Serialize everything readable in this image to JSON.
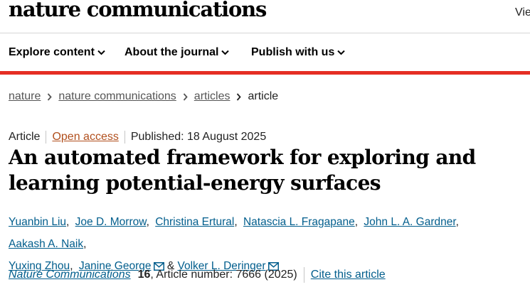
{
  "header": {
    "logo_text": "nature communications",
    "view_text": "Vie"
  },
  "nav": {
    "items": [
      {
        "label": "Explore content"
      },
      {
        "label": "About the journal"
      },
      {
        "label": "Publish with us"
      }
    ]
  },
  "breadcrumb": {
    "items": [
      "nature",
      "nature communications",
      "articles"
    ],
    "current": "article"
  },
  "article": {
    "type": "Article",
    "access": "Open access",
    "published": "Published: 18 August 2025",
    "title": "An automated framework for exploring and learning potential-energy surfaces",
    "authors": [
      "Yuanbin Liu",
      "Joe D. Morrow",
      "Christina Ertural",
      "Natascia L. Fragapane",
      "John L. A. Gardner",
      "Aakash A. Naik",
      "Yuxing Zhou",
      "Janine George",
      "Volker L. Deringer"
    ],
    "author_sep": ",",
    "author_and": "&",
    "journal": "Nature Communications",
    "volume": "16",
    "article_number": ", Article number: 7666 (2025)",
    "cite_label": "Cite this article"
  },
  "colors": {
    "link": "#025e8d",
    "accent_bar": "#e52e24",
    "open_access": "#b14f1d"
  },
  "icons": [
    "chevron-down-icon",
    "chevron-right-icon",
    "mail-icon"
  ]
}
